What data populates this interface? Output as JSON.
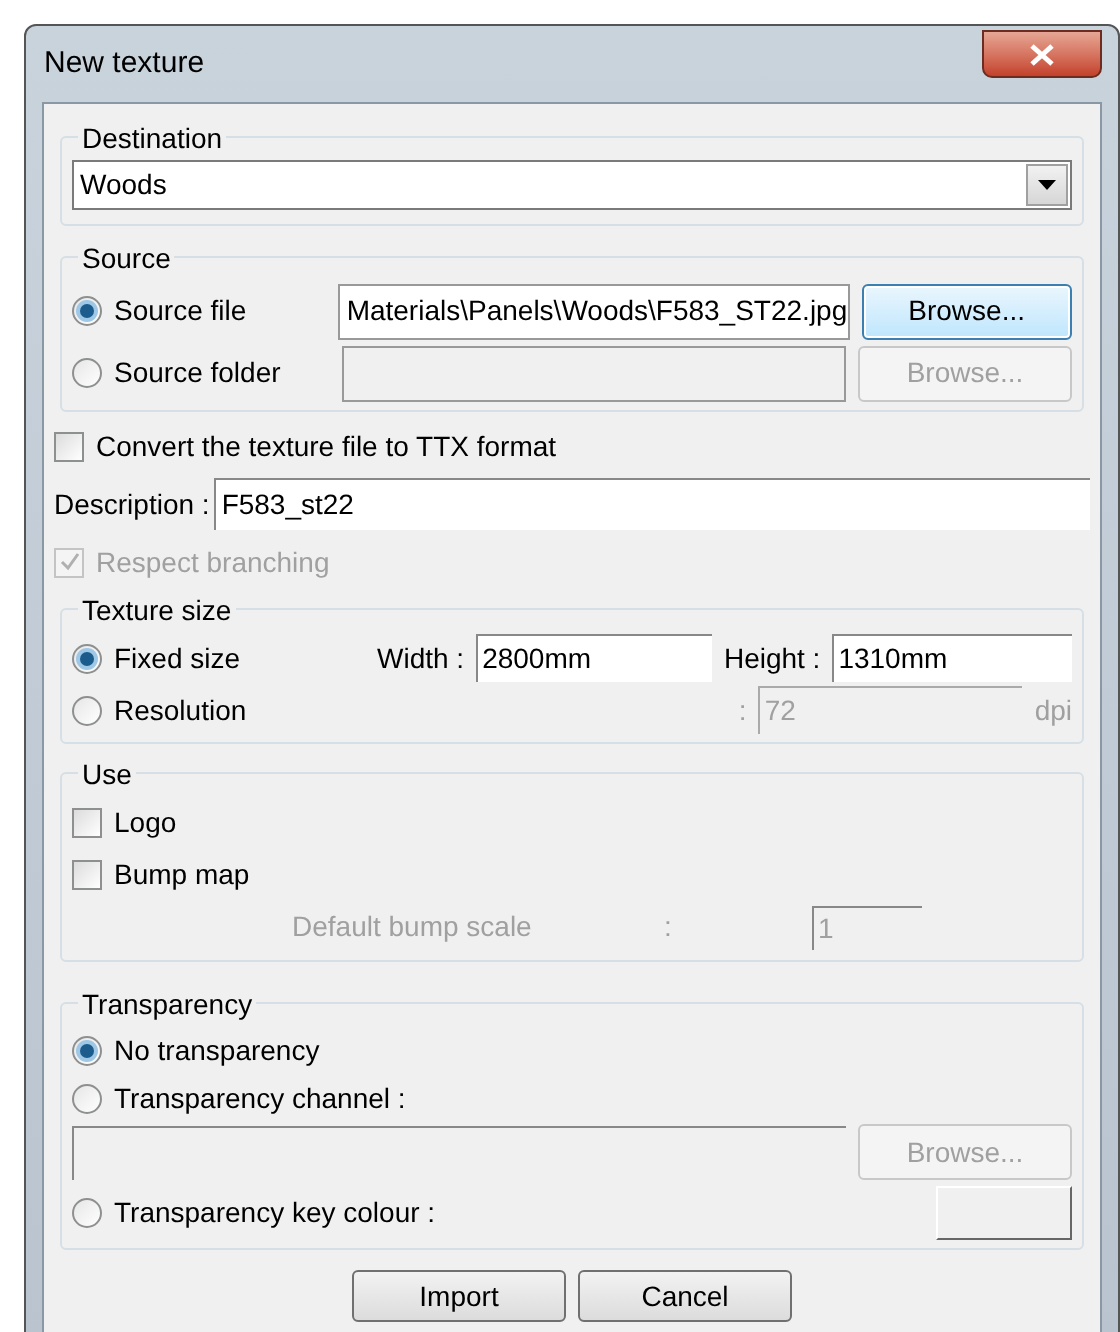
{
  "window": {
    "title": "New texture"
  },
  "destination": {
    "label": "Destination",
    "value": "Woods"
  },
  "source": {
    "label": "Source",
    "options": [
      {
        "label": "Source file",
        "selected": true,
        "value": "Materials\\Panels\\Woods\\F583_ST22.jpg",
        "button": {
          "label": "Browse...",
          "disabled": false,
          "focused": true
        }
      },
      {
        "label": "Source folder",
        "selected": false,
        "button": {
          "label": "Browse...",
          "disabled": true,
          "focused": false
        }
      }
    ]
  },
  "convert": {
    "label": "Convert the texture file to TTX format",
    "checked": false,
    "disabled": false
  },
  "description": {
    "label": "Description :",
    "value": "F583_st22"
  },
  "respect_branching": {
    "label": "Respect branching",
    "checked": true,
    "disabled": true
  },
  "texture_size": {
    "label": "Texture size",
    "options": [
      {
        "label": "Fixed size",
        "selected": true
      },
      {
        "label": "Resolution",
        "selected": false
      }
    ],
    "width": {
      "label": "Width :",
      "value": "2800mm"
    },
    "height": {
      "label": "Height :",
      "value": "1310mm"
    },
    "resolution": {
      "separator": ":",
      "value": "72",
      "unit": "dpi",
      "disabled": true
    }
  },
  "use": {
    "label": "Use",
    "checkboxes": [
      {
        "label": "Logo",
        "checked": false,
        "disabled": false
      },
      {
        "label": "Bump map",
        "checked": false,
        "disabled": false
      }
    ],
    "bump_scale": {
      "label": "Default bump scale",
      "separator": ":",
      "value": "1",
      "disabled": true
    }
  },
  "transparency": {
    "label": "Transparency",
    "options": [
      {
        "label": "No transparency",
        "selected": true
      },
      {
        "label": "Transparency channel :",
        "selected": false
      },
      {
        "label": "Transparency key colour :",
        "selected": false
      }
    ],
    "channel_button": {
      "label": "Browse...",
      "disabled": true
    }
  },
  "buttons": [
    {
      "label": "Import"
    },
    {
      "label": "Cancel"
    }
  ]
}
